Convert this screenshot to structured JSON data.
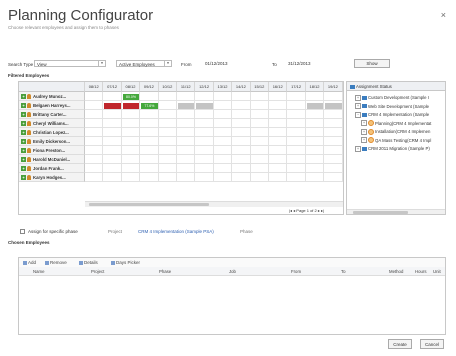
{
  "dialog": {
    "title": "Planning Configurator",
    "subtitle": "Choose relevant employees and assign them to phases",
    "close_glyph": "×"
  },
  "filters": {
    "search_type_label": "Search Type",
    "search_type_value": "View",
    "employee_filter_value": "Active Employees",
    "from_label": "From",
    "from_value": "01/12/2013",
    "to_label": "To",
    "to_value": "31/12/2013",
    "show_button": "Show"
  },
  "filtered_employees_label": "Filtered Employees",
  "grid": {
    "dates": [
      "08/12",
      "07/12",
      "08/12",
      "09/12",
      "10/12",
      "11/12",
      "12/12",
      "13/12",
      "14/12",
      "15/12",
      "16/12",
      "17/12",
      "18/12",
      "19/12"
    ],
    "employees": [
      "Audrey Munoz...",
      "Belgaen Harreys...",
      "Brittany Carter...",
      "Cheryl Williams...",
      "Christian Lopez...",
      "Emily Dickerson...",
      "Fiona Preston...",
      "Harold McDaniel...",
      "Jordan Frank...",
      "Karyn Hodges..."
    ],
    "bar_labels": {
      "green_top": "80.0%",
      "green_row2": "77.6%"
    },
    "pager": "Page 1 of 2"
  },
  "assignment_status": {
    "header": "Assignment Status",
    "items": [
      "Custom Development (Sample I",
      "Web Site Development (Sample",
      "CRM 4 Implementation (Sample",
      "Planning(CRM 4 Implementat",
      "Installation(CRM 4 Implemen",
      "QA Mass Testing(CRM 4 Impl",
      "CRM 2011 Migration (Sample P)"
    ]
  },
  "assign": {
    "checkbox_label": "Assign for specific phase",
    "project_label": "Project",
    "project_value": "CRM 4 Implementation (Sample PSA)",
    "phase_label": "Phase"
  },
  "chosen_employees_label": "Chosen Employees",
  "toolbar": {
    "add": "Add",
    "remove": "Remove",
    "details": "Details",
    "days_picker": "Days Picker"
  },
  "columns": [
    "Name",
    "Project",
    "Phase",
    "Job",
    "From",
    "To",
    "Method",
    "Hours",
    "Unit"
  ],
  "footer": {
    "create": "Create",
    "cancel": "Cancel"
  },
  "colors": {
    "green": "#45a83c",
    "red": "#c0262c",
    "grey_bar": "#c4c4c4",
    "accent": "#3b7dbf"
  }
}
